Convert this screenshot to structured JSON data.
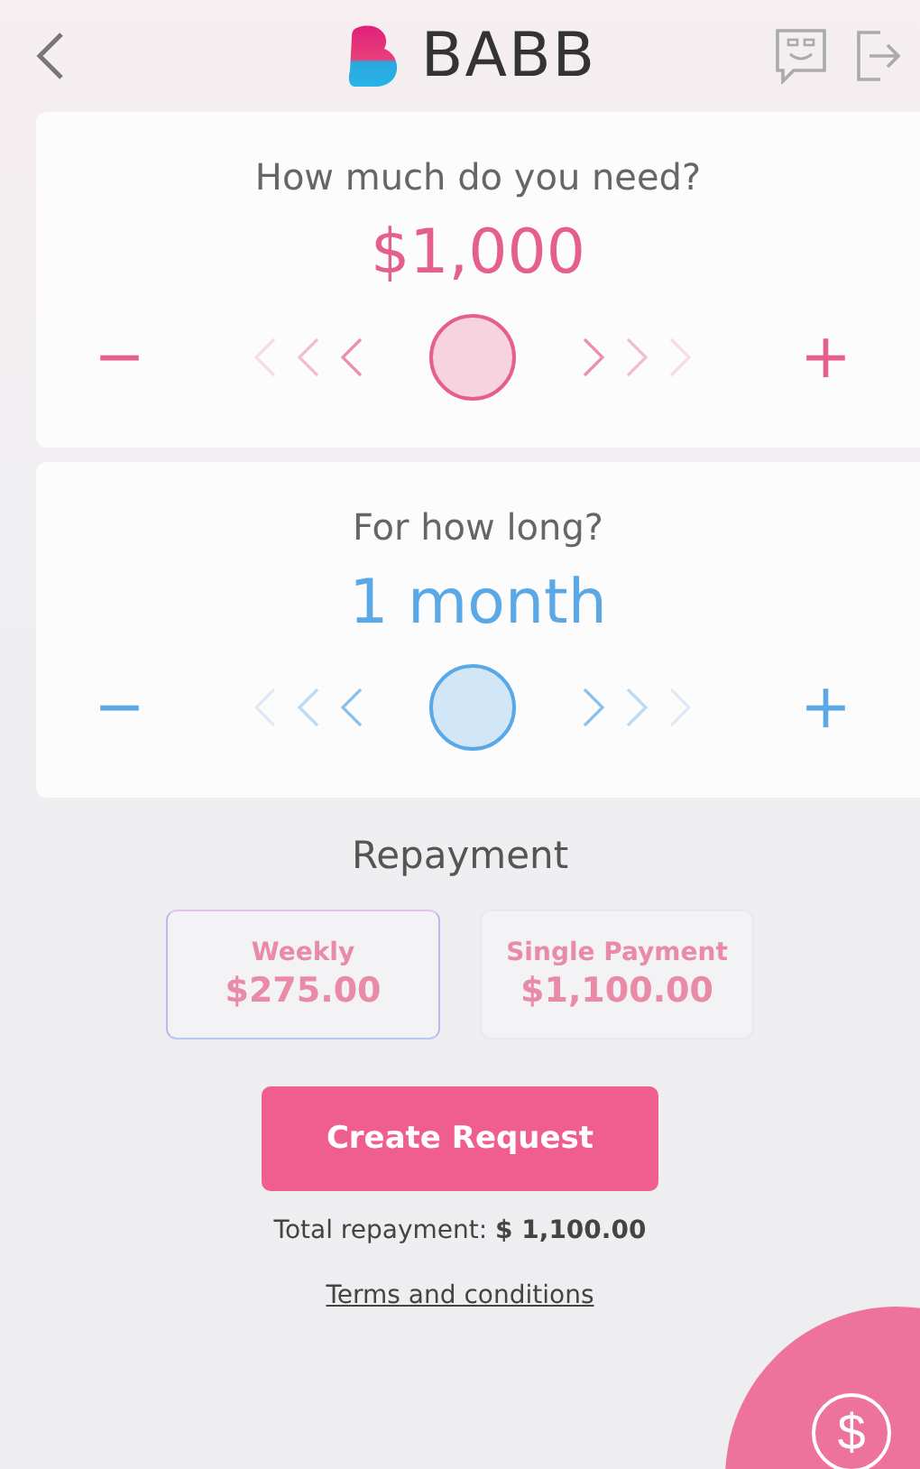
{
  "header": {
    "title": "BABB"
  },
  "sliders": [
    {
      "question": "How much do you need?",
      "value": "$1,000",
      "color": "#e4608a",
      "decrease": "−",
      "increase": "+"
    },
    {
      "question": "For how long?",
      "value": "1 month",
      "color": "#5aa8e6",
      "decrease": "−",
      "increase": "+"
    }
  ],
  "repayment": {
    "title": "Repayment",
    "options": [
      {
        "label": "Weekly",
        "amount": "$275.00",
        "selected": true
      },
      {
        "label": "Single Payment",
        "amount": "$1,100.00",
        "selected": false
      }
    ]
  },
  "create_button": "Create Request",
  "total": "Total repayment: **$ 1,100.00**",
  "terms_link": "Terms and conditions",
  "fab_symbol": "$"
}
